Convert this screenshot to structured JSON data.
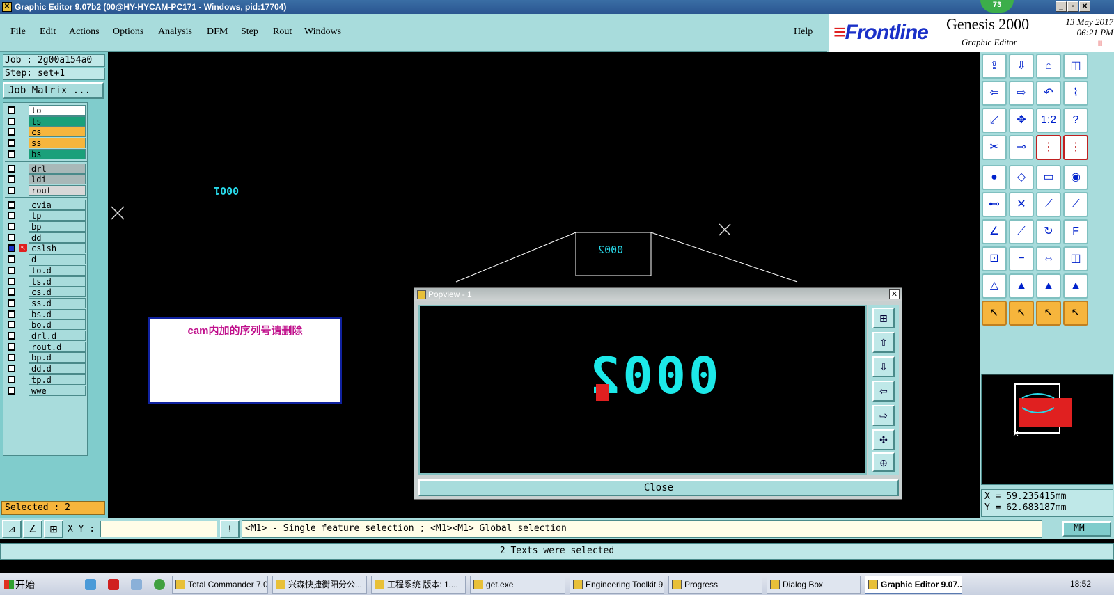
{
  "window": {
    "title": "Graphic Editor 9.07b2 (00@HY-HYCAM-PC171 - Windows, pid:17704)",
    "badge": "73",
    "min_label": "_",
    "max_label": "▫",
    "close_label": "✕"
  },
  "menu": {
    "items": [
      "File",
      "Edit",
      "Actions",
      "Options",
      "Analysis",
      "DFM",
      "Step",
      "Rout",
      "Windows"
    ],
    "help": "Help"
  },
  "brand": {
    "logo_stripes": "≡",
    "logo": "Frontline",
    "product": "Genesis 2000",
    "subtitle": "Graphic Editor",
    "date": "13 May 2017",
    "time": "06:21 PM",
    "pause": "II"
  },
  "left": {
    "job": "Job : 2g00a154a0",
    "step": "Step: set+1",
    "job_matrix": "Job Matrix ...",
    "selected": "Selected : 2",
    "layers": [
      {
        "name": "to",
        "color": "#ffffff"
      },
      {
        "name": "ts",
        "color": "#1aa07a"
      },
      {
        "name": "cs",
        "color": "#f6b53c"
      },
      {
        "name": "ss",
        "color": "#f6b53c"
      },
      {
        "name": "bs",
        "color": "#1aa07a"
      },
      {
        "name": "drl",
        "color": "#a8b8b8"
      },
      {
        "name": "ldi",
        "color": "#a8b8b8"
      },
      {
        "name": "rout",
        "color": "#d8d8d8"
      },
      {
        "name": "cvia",
        "color": "#a8dcdc"
      },
      {
        "name": "tp",
        "color": "#a8dcdc"
      },
      {
        "name": "bp",
        "color": "#a8dcdc"
      },
      {
        "name": "dd",
        "color": "#a8dcdc"
      },
      {
        "name": "cslsh",
        "color": "#a8dcdc"
      },
      {
        "name": "d",
        "color": "#a8dcdc"
      },
      {
        "name": "to.d",
        "color": "#a8dcdc"
      },
      {
        "name": "ts.d",
        "color": "#a8dcdc"
      },
      {
        "name": "cs.d",
        "color": "#a8dcdc"
      },
      {
        "name": "ss.d",
        "color": "#a8dcdc"
      },
      {
        "name": "bs.d",
        "color": "#a8dcdc"
      },
      {
        "name": "bo.d",
        "color": "#a8dcdc"
      },
      {
        "name": "drl.d",
        "color": "#a8dcdc"
      },
      {
        "name": "rout.d",
        "color": "#a8dcdc"
      },
      {
        "name": "bp.d",
        "color": "#a8dcdc"
      },
      {
        "name": "dd.d",
        "color": "#a8dcdc"
      },
      {
        "name": "tp.d",
        "color": "#a8dcdc"
      },
      {
        "name": "wwe",
        "color": "#a8dcdc"
      }
    ]
  },
  "canvas": {
    "text_small": "0001",
    "text_box": "0002",
    "note": "cam内加的序列号请删除"
  },
  "popview": {
    "title": "Popview - 1",
    "text": "0002",
    "close": "Close",
    "close_x": "✕"
  },
  "coords": {
    "x": "X = 59.235415mm",
    "y": "Y = 62.683187mm"
  },
  "command": {
    "xy_label": "X Y :",
    "xy_value": "",
    "exclaim": "!",
    "hint": "<M1> - Single feature selection ; <M1><M1> Global selection",
    "units": "MM"
  },
  "status": "2 Texts were selected",
  "taskbar": {
    "start": "开始",
    "items": [
      "Total Commander 7.0...",
      "兴森快捷衡阳分公...",
      "工程系统  版本: 1....",
      "get.exe",
      "Engineering Toolkit 9....",
      "Progress",
      "Dialog Box",
      "Graphic Editor 9.07..."
    ],
    "clock": "18:52"
  }
}
